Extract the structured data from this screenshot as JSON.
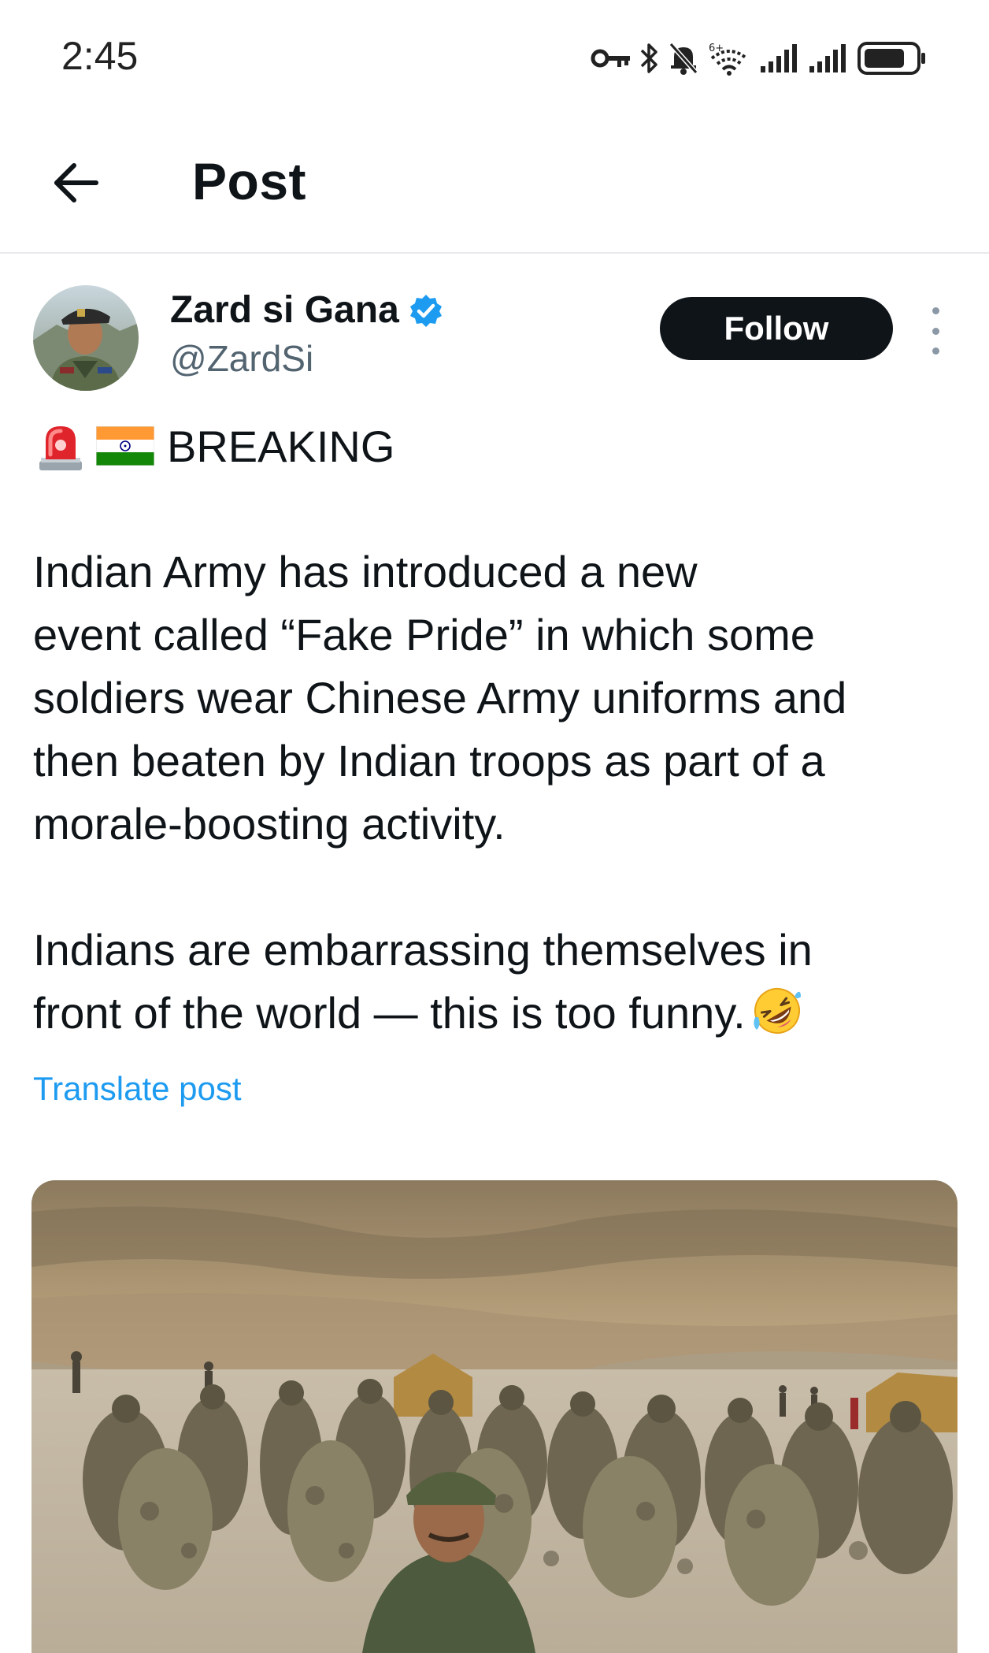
{
  "status_bar": {
    "time": "2:45",
    "icons": [
      "key-icon",
      "bluetooth-icon",
      "bell-muted-icon",
      "wifi-icon",
      "signal-icon",
      "signal-icon",
      "battery-icon"
    ]
  },
  "header": {
    "back_icon": "arrow-left-icon",
    "title": "Post"
  },
  "author": {
    "name": "Zard si Gana",
    "verified": true,
    "handle": "@ZardSi",
    "follow_label": "Follow"
  },
  "post": {
    "emoji_prefix": [
      "police-light-emoji",
      "india-flag-emoji"
    ],
    "breaking": "BREAKING",
    "paragraph1": [
      "Indian Army has introduced a new",
      "event called “Fake Pride” in which some",
      "soldiers wear Chinese Army uniforms and",
      "then beaten by Indian troops as part of a",
      "morale-boosting activity."
    ],
    "paragraph2": [
      "Indians are embarrassing themselves in",
      "front of the world — this is too funny."
    ],
    "paragraph2_emoji": "rolling-laughing-emoji",
    "translate_label": "Translate post"
  },
  "media": {
    "type": "photo"
  },
  "colors": {
    "accent": "#1d9bf0",
    "text_primary": "#0f1419",
    "text_secondary": "#536471",
    "follow_bg": "#0f1419",
    "divider": "#e7e9ea"
  }
}
